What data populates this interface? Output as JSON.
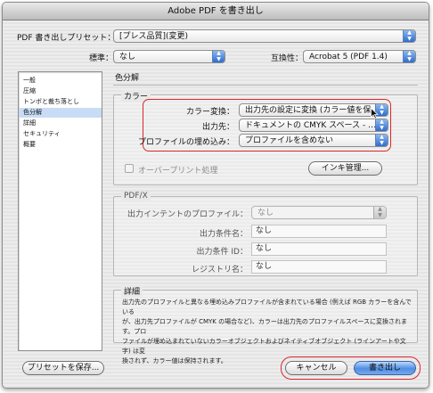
{
  "window": {
    "title": "Adobe PDF を書き出し"
  },
  "header": {
    "preset_label": "PDF 書き出しプリセット：",
    "preset_value": "[プレス品質](変更)",
    "standard_label": "標準：",
    "standard_value": "なし",
    "compat_label": "互換性：",
    "compat_value": "Acrobat 5 (PDF 1.4)"
  },
  "sidebar": {
    "items": [
      {
        "label": "一般"
      },
      {
        "label": "圧縮"
      },
      {
        "label": "トンボと裁ち落とし"
      },
      {
        "label": "色分解"
      },
      {
        "label": "詳細"
      },
      {
        "label": "セキュリティ"
      },
      {
        "label": "概要"
      }
    ],
    "selected_index": 3
  },
  "main": {
    "section_title": "色分解",
    "color_group": {
      "title": "カラー",
      "conversion_label": "カラー変換：",
      "conversion_value": "出力先の設定に変換 (カラー値を保…",
      "destination_label": "出力先：",
      "destination_value": "ドキュメントの CMYK スペース - …",
      "profile_label": "プロファイルの埋め込み：",
      "profile_value": "プロファイルを含めない",
      "overprint_label": "オーバープリント処理",
      "ink_button": "インキ管理..."
    },
    "pdfx_group": {
      "title": "PDF/X",
      "intent_label": "出力インテントのプロファイル：",
      "intent_value": "なし",
      "condition_name_label": "出力条件名：",
      "condition_name_value": "なし",
      "condition_id_label": "出力条件 ID：",
      "condition_id_value": "なし",
      "registry_label": "レジストリ名：",
      "registry_value": "なし"
    },
    "details_group": {
      "title": "詳細",
      "line1": "出力先のプロファイルと異なる埋め込みプロファイルが含まれている場合 (例えば RGB カラーを含んでいる",
      "line2": "が、出力先プロファイルが CMYK の場合など)、カラーは出力先のプロファイルスペースに変換されます。プロ",
      "line3": "ファイルが埋め込まれていないカラーオブジェクトおよびネイティブオブジェクト (ラインアートや文字) は変",
      "line4": "換されず、カラー値は保持されます。"
    }
  },
  "footer": {
    "save_preset": "プリセットを保存...",
    "cancel": "キャンセル",
    "export": "書き出し"
  },
  "colors": {
    "selection": "#c8dcf5",
    "highlight": "#d9262c",
    "accent": "#3a78d8"
  }
}
